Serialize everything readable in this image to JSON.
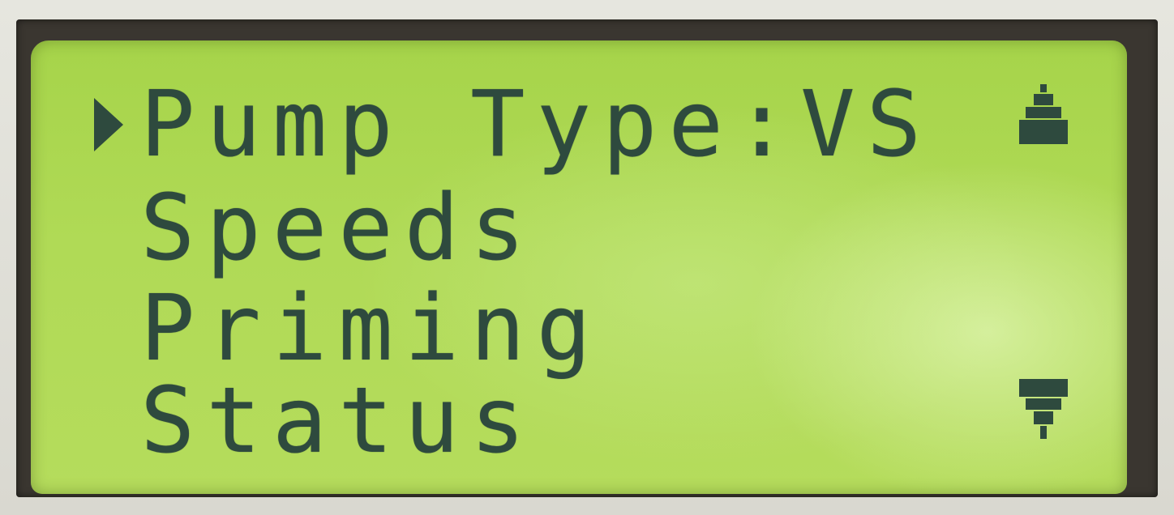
{
  "menu": {
    "items": [
      {
        "label": "Pump Type:VS",
        "selected": true
      },
      {
        "label": "Speeds",
        "selected": false
      },
      {
        "label": "Priming",
        "selected": false
      },
      {
        "label": "Status",
        "selected": false
      }
    ]
  },
  "icons": {
    "cursor": "selection-cursor-icon",
    "scroll_up": "scroll-up-arrow-icon",
    "scroll_down": "scroll-down-arrow-icon"
  },
  "colors": {
    "lcd_background": "#b0da56",
    "pixel_on": "#2e4a3e",
    "bezel": "#3a3630"
  }
}
